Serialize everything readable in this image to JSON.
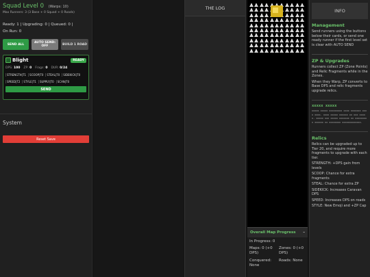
{
  "squad": {
    "title": "Squad Level 0",
    "warps": "(Warps: 10)",
    "max_runners": "Max Runners: 3 (3 Base + 0 Squad + 0 Roads)",
    "status_line1": "Ready: 1 | Upgrading: 0 | Queued: 0 |",
    "status_line2": "On Run: 0",
    "buttons": {
      "send_all": "SEND ALL",
      "auto_send": "AUTO SEND: OFF",
      "build_road": "BUILD 1 ROAD"
    }
  },
  "runner": {
    "name": "Blight",
    "badge": "READY",
    "dps_label": "DPS:",
    "dps": "100",
    "zp_label": "ZP:",
    "zp": "0",
    "frags_label": "Frags:",
    "frags": "0",
    "dur_label": "DUR:",
    "dur": "0/24",
    "relics_row1": [
      "STRENGTH|T1",
      "SCOOP|T0",
      "STEAL|T0",
      "SIDEKICK|T0"
    ],
    "relics_row2": [
      "SPEED|T2",
      "STYLE|T1",
      "SUPPLY|T0",
      "SCAN|T0"
    ],
    "send_label": "SEND"
  },
  "system": {
    "title": "System",
    "reset_label": "Reset Save"
  },
  "log": {
    "title": "THE LOG"
  },
  "progress": {
    "title": "Overall Map Progress",
    "collapse": "–",
    "in_progress": "In Progress: 0",
    "maps": "Maps: 0 (+0 DPS)",
    "zones": "Zones: 0 (+0 DPS)",
    "conquered": "Conquered: None",
    "roads": "Roads: None"
  },
  "info": {
    "title": "INFO",
    "management_title": "Management",
    "management_text": "Send runners using the buttons below their cards, or send one ready runner if the first level set is clear with AUTO SEND",
    "zp_title": "ZP & Upgrades",
    "zp_text1": "Runners collect ZP (Zone Points) and Relic Fragments while in the Zones.",
    "zp_text2": "When they Warp, ZP converts to Base DPS and relic fragments upgrade relics.",
    "scramble_title": "xxxxx xxxxx",
    "scramble_text": "xxxxx xxxxx xxxxxxxxx xxxx xxxxxxx xxxx xxxx. xxxx xxxxx xxxxxx xx xxx xxxxx. xxxxx xxx xxxxx xxxxxxx xx xxxxxxxxx xxxxxx xx xxxxxxxx xxxxxxxxxxxxx.",
    "relics_title": "Relics",
    "relics_text": "Relics can be upgraded up to Tier 20, and require more fragments to upgrade with each tier.",
    "relic_strength": "STRENGTH: +DPS gain from levels",
    "relic_scoop": "SCOOP: Chance for extra fragments",
    "relic_steal": "STEAL: Chance for extra ZP",
    "relic_sidekick": "SIDEKICK: Increases Caravan DPS",
    "relic_speed": "SPEED: Increases DPS on roads",
    "relic_style": "STYLE: New Emoji and +ZP Cap"
  },
  "colors": {
    "accent_green": "#6bc36b",
    "button_green": "#2e9a45",
    "reset_red": "#e23e37",
    "map_gold": "#d6b21e"
  },
  "icons": [
    "runner-avatar-icon",
    "mountain-tile-icon"
  ]
}
